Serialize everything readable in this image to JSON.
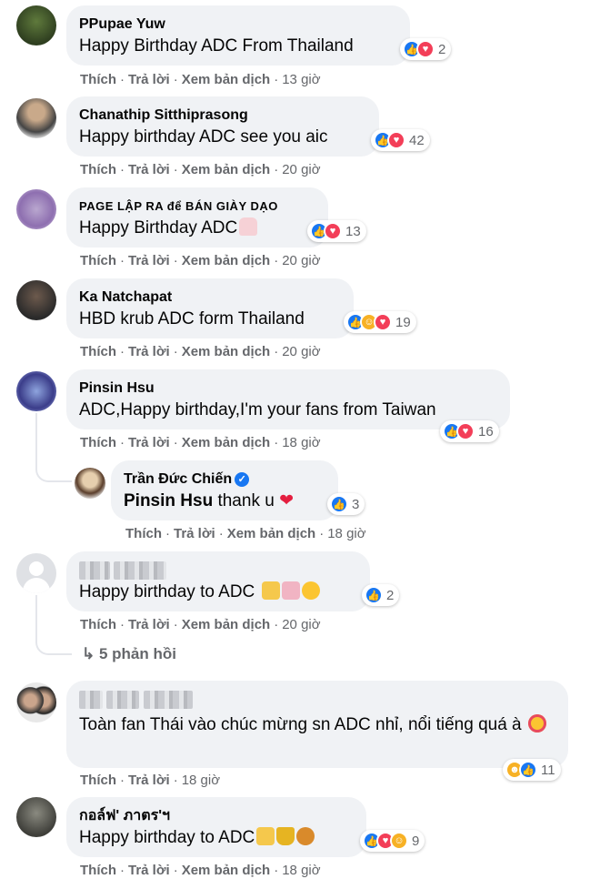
{
  "comments": [
    {
      "name": "PPupae Yuw",
      "text": "Happy Birthday ADC From Thailand",
      "reaction_count": "2",
      "time": "13 giờ"
    },
    {
      "name": "Chanathip Sitthiprasong",
      "text": "Happy birthday ADC see you aic",
      "reaction_count": "42",
      "time": "20 giờ"
    },
    {
      "name": "PAGE LẬP RA để BÁN GIÀY DẠO",
      "text": "Happy Birthday ADC",
      "reaction_count": "13",
      "time": "20 giờ"
    },
    {
      "name": "Ka Natchapat",
      "text": "HBD krub ADC form Thailand",
      "reaction_count": "19",
      "time": "20 giờ"
    },
    {
      "name": "Pinsin Hsu",
      "text": "ADC,Happy birthday,I'm your fans from Taiwan",
      "reaction_count": "16",
      "time": "18 giờ"
    },
    {
      "name": "Trần Đức Chiến",
      "mention": "Pinsin Hsu",
      "text": " thank u ",
      "heart": "❤",
      "reaction_count": "3",
      "time": "18 giờ"
    },
    {
      "text": "Happy birthday to ADC",
      "reaction_count": "2",
      "time": "20 giờ"
    },
    {
      "text": "Toàn fan Thái vào chúc mừng sn ADC nhỉ, nổi tiếng quá à",
      "reaction_count": "11",
      "time": "18 giờ"
    },
    {
      "name": "กอล์ฟ' ภาตร'ฯ",
      "text": "Happy birthday to ADC",
      "reaction_count": "9",
      "time": "18 giờ"
    }
  ],
  "actions": {
    "like": "Thích",
    "reply": "Trả lời",
    "translate": "Xem bản dịch",
    "sep": "·"
  },
  "replies_link": "↳ 5 phản hồi",
  "colors": {
    "bubble": "#f0f2f5",
    "meta": "#65676b",
    "like": "#1877f2",
    "love": "#f33e58"
  }
}
